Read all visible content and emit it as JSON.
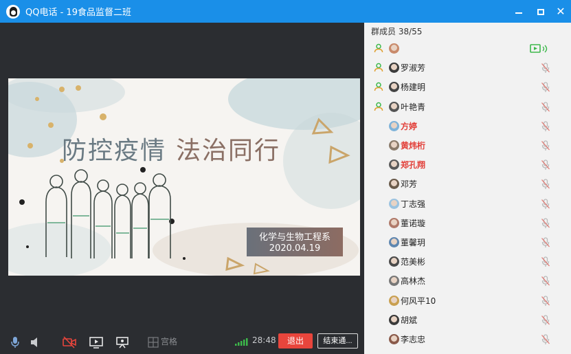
{
  "window": {
    "title": "QQ电话 - 19食品监督二班",
    "controls": [
      "minimize",
      "maximize",
      "close"
    ]
  },
  "slide": {
    "title_part1": "防控疫情",
    "title_part2": "法治同行",
    "department": "化学与生物工程系",
    "date": "2020.04.19"
  },
  "toolbar": {
    "grid_label": "宫格",
    "call_time": "28:48",
    "exit_label": "退出",
    "end_call_label": "结束通..."
  },
  "members": {
    "header": "群成员 38/55",
    "items": [
      {
        "name": "",
        "speaking": true,
        "sharing": true,
        "host": false,
        "avatar_color": "#c98a6b"
      },
      {
        "name": "罗淑芳",
        "speaking": true,
        "sharing": false,
        "host": false,
        "avatar_color": "#3c3c3c"
      },
      {
        "name": "杨建明",
        "speaking": true,
        "sharing": false,
        "host": false,
        "avatar_color": "#444444"
      },
      {
        "name": "叶艳青",
        "speaking": true,
        "sharing": false,
        "host": false,
        "avatar_color": "#555555"
      },
      {
        "name": "方婷",
        "speaking": false,
        "sharing": false,
        "host": true,
        "avatar_color": "#7fb3d9"
      },
      {
        "name": "黄炜桁",
        "speaking": false,
        "sharing": false,
        "host": true,
        "avatar_color": "#8a7a6a"
      },
      {
        "name": "郑孔翔",
        "speaking": false,
        "sharing": false,
        "host": true,
        "avatar_color": "#5a5a5a"
      },
      {
        "name": "邓芳",
        "speaking": false,
        "sharing": false,
        "host": false,
        "avatar_color": "#6a5a4a"
      },
      {
        "name": "丁志强",
        "speaking": false,
        "sharing": false,
        "host": false,
        "avatar_color": "#9bc3e0"
      },
      {
        "name": "董诺璇",
        "speaking": false,
        "sharing": false,
        "host": false,
        "avatar_color": "#b07a6a"
      },
      {
        "name": "董馨玥",
        "speaking": false,
        "sharing": false,
        "host": false,
        "avatar_color": "#5f87b0"
      },
      {
        "name": "范美彬",
        "speaking": false,
        "sharing": false,
        "host": false,
        "avatar_color": "#4a4a4a"
      },
      {
        "name": "高林杰",
        "speaking": false,
        "sharing": false,
        "host": false,
        "avatar_color": "#777777"
      },
      {
        "name": "何风平10",
        "speaking": false,
        "sharing": false,
        "host": false,
        "avatar_color": "#c9a050"
      },
      {
        "name": "胡斌",
        "speaking": false,
        "sharing": false,
        "host": false,
        "avatar_color": "#3a3a3a"
      },
      {
        "name": "李志忠",
        "speaking": false,
        "sharing": false,
        "host": false,
        "avatar_color": "#8a5a4a"
      }
    ]
  },
  "colors": {
    "titlebar": "#1a8fe8",
    "exit_button": "#e8453c",
    "host_name": "#e2403a",
    "speaking_green": "#3cb84a"
  }
}
